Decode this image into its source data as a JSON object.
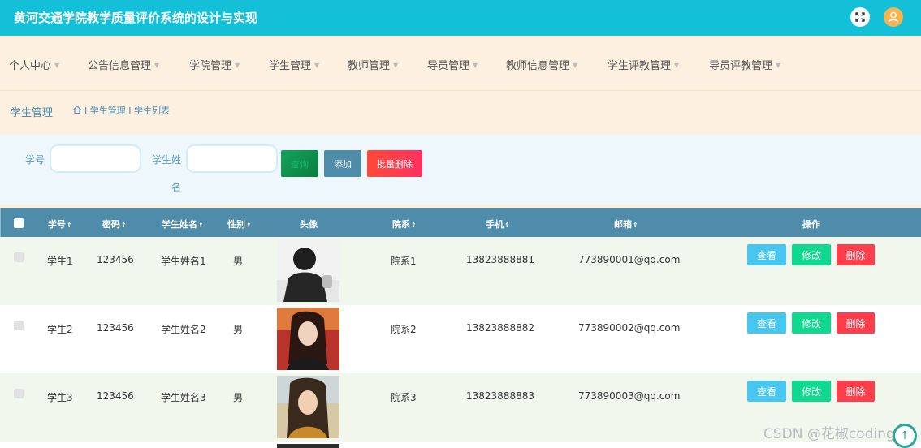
{
  "header": {
    "title": "黄河交通学院教学质量评价系统的设计与实现"
  },
  "nav": [
    {
      "label": "个人中心"
    },
    {
      "label": "公告信息管理"
    },
    {
      "label": "学院管理"
    },
    {
      "label": "学生管理"
    },
    {
      "label": "教师管理"
    },
    {
      "label": "导员管理"
    },
    {
      "label": "教师信息管理"
    },
    {
      "label": "学生评教管理"
    },
    {
      "label": "导员评教管理"
    }
  ],
  "breadcrumb": {
    "section": "学生管理",
    "path": "I 学生管理 I 学生列表"
  },
  "search": {
    "id_label": "学号",
    "id_value": "",
    "name_label_line1": "学生姓",
    "name_label_line2": "名",
    "name_value": "",
    "query_label": "查询",
    "add_label": "添加",
    "batch_delete_label": "批量删除"
  },
  "table": {
    "headers": [
      "学号",
      "密码",
      "学生姓名",
      "性别",
      "头像",
      "院系",
      "手机",
      "邮箱",
      "操作"
    ],
    "rows": [
      {
        "id": "学生1",
        "password": "123456",
        "name": "学生姓名1",
        "gender": "男",
        "dept": "院系1",
        "phone": "13823888881",
        "email": "773890001@qq.com"
      },
      {
        "id": "学生2",
        "password": "123456",
        "name": "学生姓名2",
        "gender": "男",
        "dept": "院系2",
        "phone": "13823888882",
        "email": "773890002@qq.com"
      },
      {
        "id": "学生3",
        "password": "123456",
        "name": "学生姓名3",
        "gender": "男",
        "dept": "院系3",
        "phone": "13823888883",
        "email": "773890003@qq.com"
      }
    ],
    "actions": {
      "view": "查看",
      "edit": "修改",
      "delete": "删除"
    }
  },
  "watermark": "CSDN @花椒coding",
  "icons": {
    "fullscreen": "fullscreen-icon",
    "user": "user-icon",
    "home": "home-icon",
    "sort": "sort-icon",
    "back_to_top": "arrow-up-icon"
  },
  "colors": {
    "topbar": "#14bfd8",
    "nav_bg": "#fdf0e0",
    "table_header": "#4f8caa",
    "row_alt": "#f1f7ed",
    "view_button": "#47c7f0",
    "edit_button": "#0fd98f",
    "delete_button": "#ff3d4b",
    "batch_delete": "#ff3f4a",
    "search_button": "#13a35d"
  }
}
